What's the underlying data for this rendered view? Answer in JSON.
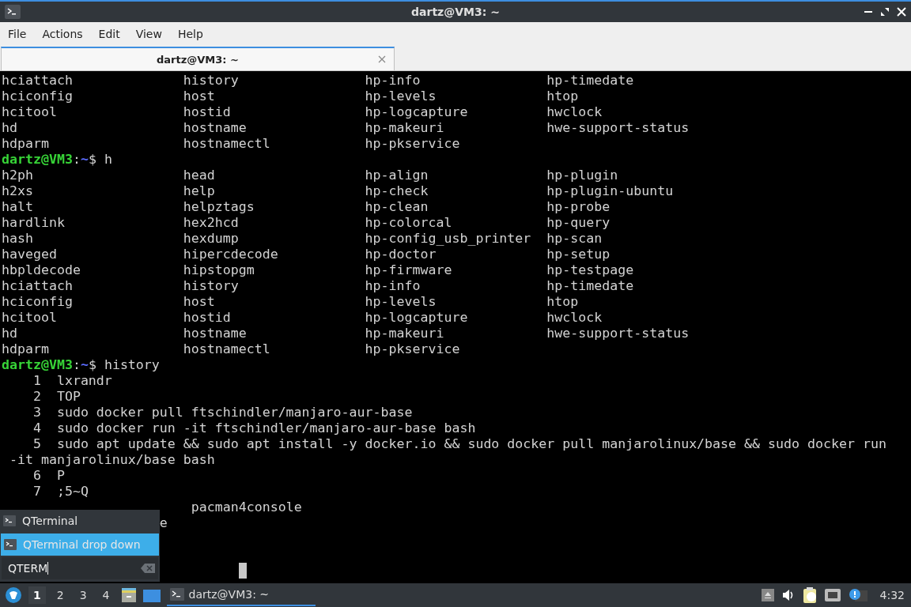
{
  "window": {
    "title": "dartz@VM3: ~"
  },
  "menu": [
    "File",
    "Actions",
    "Edit",
    "View",
    "Help"
  ],
  "tabs": [
    {
      "label": "dartz@VM3: ~",
      "selected": true
    }
  ],
  "terminal": {
    "lines": [
      {
        "kind": "columns",
        "cells": [
          "hciattach",
          "history",
          "hp-info",
          "hp-timedate"
        ]
      },
      {
        "kind": "columns",
        "cells": [
          "hciconfig",
          "host",
          "hp-levels",
          "htop"
        ]
      },
      {
        "kind": "columns",
        "cells": [
          "hcitool",
          "hostid",
          "hp-logcapture",
          "hwclock"
        ]
      },
      {
        "kind": "columns",
        "cells": [
          "hd",
          "hostname",
          "hp-makeuri",
          "hwe-support-status"
        ]
      },
      {
        "kind": "columns",
        "cells": [
          "hdparm",
          "hostnamectl",
          "hp-pkservice"
        ]
      },
      {
        "kind": "prompt",
        "user": "dartz@VM3",
        "sep": ":",
        "path": "~",
        "command": "$ h"
      },
      {
        "kind": "columns",
        "cells": [
          "h2ph",
          "head",
          "hp-align",
          "hp-plugin"
        ]
      },
      {
        "kind": "columns",
        "cells": [
          "h2xs",
          "help",
          "hp-check",
          "hp-plugin-ubuntu"
        ]
      },
      {
        "kind": "columns",
        "cells": [
          "halt",
          "helpztags",
          "hp-clean",
          "hp-probe"
        ]
      },
      {
        "kind": "columns",
        "cells": [
          "hardlink",
          "hex2hcd",
          "hp-colorcal",
          "hp-query"
        ]
      },
      {
        "kind": "columns",
        "cells": [
          "hash",
          "hexdump",
          "hp-config_usb_printer",
          "hp-scan"
        ]
      },
      {
        "kind": "columns",
        "cells": [
          "haveged",
          "hipercdecode",
          "hp-doctor",
          "hp-setup"
        ]
      },
      {
        "kind": "columns",
        "cells": [
          "hbpldecode",
          "hipstopgm",
          "hp-firmware",
          "hp-testpage"
        ]
      },
      {
        "kind": "columns",
        "cells": [
          "hciattach",
          "history",
          "hp-info",
          "hp-timedate"
        ]
      },
      {
        "kind": "columns",
        "cells": [
          "hciconfig",
          "host",
          "hp-levels",
          "htop"
        ]
      },
      {
        "kind": "columns",
        "cells": [
          "hcitool",
          "hostid",
          "hp-logcapture",
          "hwclock"
        ]
      },
      {
        "kind": "columns",
        "cells": [
          "hd",
          "hostname",
          "hp-makeuri",
          "hwe-support-status"
        ]
      },
      {
        "kind": "columns",
        "cells": [
          "hdparm",
          "hostnamectl",
          "hp-pkservice"
        ]
      },
      {
        "kind": "prompt",
        "user": "dartz@VM3",
        "sep": ":",
        "path": "~",
        "command": "$ history"
      },
      {
        "kind": "history",
        "num": "1",
        "text": "lxrandr"
      },
      {
        "kind": "history",
        "num": "2",
        "text": "TOP"
      },
      {
        "kind": "history",
        "num": "3",
        "text": "sudo docker pull ftschindler/manjaro-aur-base"
      },
      {
        "kind": "history",
        "num": "4",
        "text": "sudo docker run -it ftschindler/manjaro-aur-base bash"
      },
      {
        "kind": "history",
        "num": "5",
        "text": "sudo apt update && sudo apt install -y docker.io && sudo docker pull manjarolinux/base && sudo docker run"
      },
      {
        "kind": "wrap",
        "text": "-it manjarolinux/base bash"
      },
      {
        "kind": "history",
        "num": "6",
        "text": "P"
      },
      {
        "kind": "history",
        "num": "7",
        "text": ";5~Q"
      },
      {
        "kind": "tail",
        "text": "pacman4console"
      },
      {
        "kind": "partial",
        "text": "e"
      }
    ]
  },
  "launcher": {
    "items": [
      {
        "label": "QTerminal",
        "selected": false
      },
      {
        "label": "QTerminal drop down",
        "selected": true
      }
    ],
    "search": {
      "value": "QTERM"
    }
  },
  "taskbar": {
    "desktops": [
      {
        "label": "1",
        "selected": true
      },
      {
        "label": "2",
        "selected": false
      },
      {
        "label": "3",
        "selected": false
      },
      {
        "label": "4",
        "selected": false
      }
    ],
    "task": {
      "label": "dartz@VM3: ~"
    },
    "clock": "4:32"
  }
}
